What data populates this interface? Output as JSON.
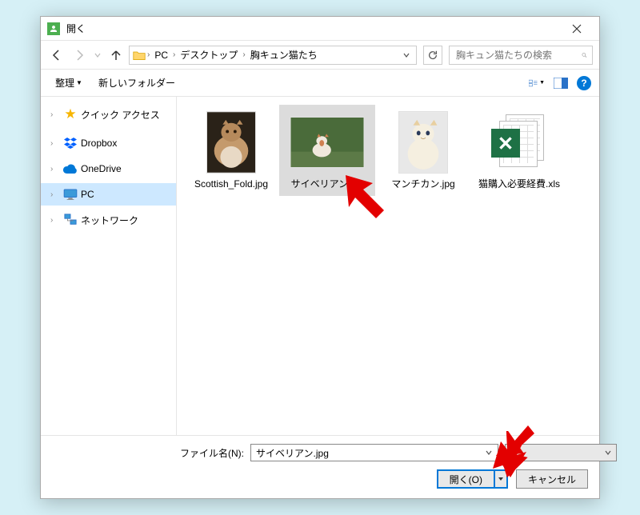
{
  "title": "開く",
  "breadcrumb": {
    "seg1": "PC",
    "seg2": "デスクトップ",
    "seg3": "胸キュン猫たち"
  },
  "search": {
    "placeholder": "胸キュン猫たちの検索"
  },
  "toolbar": {
    "organize": "整理",
    "newfolder": "新しいフォルダー"
  },
  "sidebar": {
    "quick": "クイック アクセス",
    "dropbox": "Dropbox",
    "onedrive": "OneDrive",
    "pc": "PC",
    "network": "ネットワーク"
  },
  "files": [
    {
      "name": "Scottish_Fold.jpg"
    },
    {
      "name": "サイベリアン.jpg"
    },
    {
      "name": "マンチカン.jpg"
    },
    {
      "name": "猫購入必要経費.xls"
    }
  ],
  "footer": {
    "fn_label": "ファイル名(N):",
    "fn_value": "サイベリアン.jpg",
    "filter": "*.*",
    "open": "開く(O)",
    "cancel": "キャンセル"
  }
}
